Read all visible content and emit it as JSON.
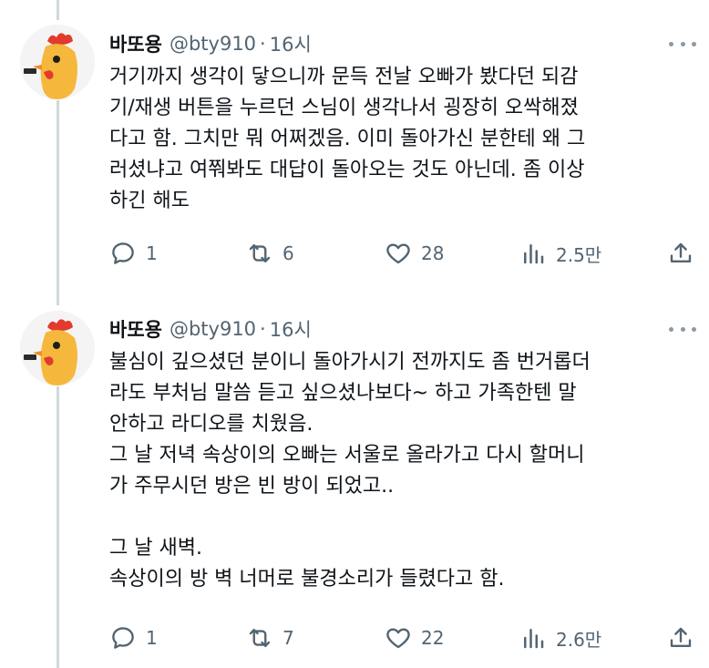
{
  "tweets": [
    {
      "author": {
        "name": "바또용",
        "handle": "@bty910",
        "time": "16시"
      },
      "lines": [
        "거기까지 생각이 닿으니까 문득 전날 오빠가 봤다던 되감",
        "기/재생 버튼을 누르던 스님이 생각나서 굉장히 오싹해졌",
        "다고 함. 그치만 뭐 어쩌겠음. 이미 돌아가신 분한테 왜 그",
        "러셨냐고 여쭤봐도 대답이 돌아오는 것도 아닌데. 좀 이상",
        "하긴 해도"
      ],
      "actions": {
        "reply": "1",
        "retweet": "6",
        "like": "28",
        "views": "2.5만"
      }
    },
    {
      "author": {
        "name": "바또용",
        "handle": "@bty910",
        "time": "16시"
      },
      "lines": [
        "불심이 깊으셨던 분이니 돌아가시기 전까지도 좀 번거롭더",
        "라도 부처님 말씀 듣고 싶으셨나보다~ 하고 가족한텐 말",
        "안하고 라디오를 치웠음.",
        "그 날 저녁 속상이의 오빠는 서울로 올라가고 다시 할머니",
        "가 주무시던 방은 빈 방이 되었고..",
        "",
        "그 날 새벽.",
        "속상이의 방 벽 너머로 불경소리가 들렸다고 함."
      ],
      "actions": {
        "reply": "1",
        "retweet": "7",
        "like": "22",
        "views": "2.6만"
      }
    }
  ],
  "icons": {
    "avatar": "rooster-avatar",
    "more": "more-icon",
    "reply": "reply-icon",
    "retweet": "retweet-icon",
    "like": "heart-icon",
    "views": "views-icon",
    "share": "share-icon"
  },
  "colors": {
    "muted": "#536471",
    "thread_line": "#cfd9de",
    "text": "#0f1419"
  }
}
